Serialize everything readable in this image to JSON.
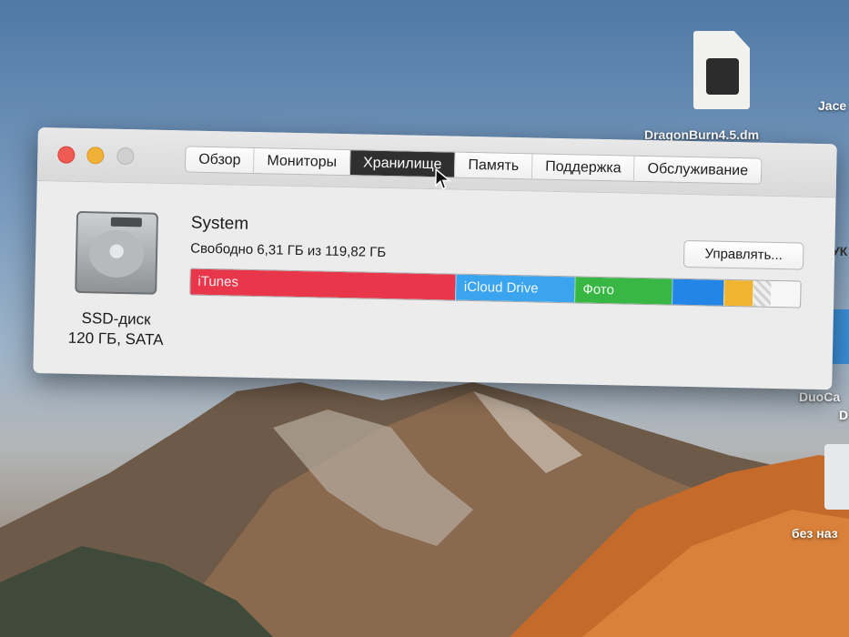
{
  "desktop": {
    "file_label": "DragonBurn4.5.dm",
    "edge_label_1": "Jace",
    "edge_label_2": "DuoCa",
    "edge_label_3": "без наз",
    "edge_letters_a": "УК",
    "edge_letters_b": "D"
  },
  "window": {
    "tabs": [
      {
        "label": "Обзор",
        "active": false
      },
      {
        "label": "Мониторы",
        "active": false
      },
      {
        "label": "Хранилище",
        "active": true
      },
      {
        "label": "Память",
        "active": false
      },
      {
        "label": "Поддержка",
        "active": false
      },
      {
        "label": "Обслуживание",
        "active": false
      }
    ],
    "disk": {
      "name_line1": "SSD-диск",
      "name_line2": "120 ГБ, SATA"
    },
    "volume": {
      "name": "System",
      "free_text": "Свободно 6,31 ГБ из 119,82 ГБ",
      "manage_label": "Управлять..."
    },
    "storage_bar": [
      {
        "label": "iTunes",
        "fraction": 0.435,
        "color": "#e8364a"
      },
      {
        "label": "iCloud Drive",
        "fraction": 0.195,
        "color": "#3aa4ef"
      },
      {
        "label": "Фото",
        "fraction": 0.16,
        "color": "#38b745"
      },
      {
        "label": "",
        "fraction": 0.085,
        "color": "#2385e6"
      },
      {
        "label": "",
        "fraction": 0.047,
        "color": "#f0b431"
      },
      {
        "label": "",
        "fraction": 0.03,
        "color": "hatched"
      },
      {
        "label": "",
        "fraction": 0.048,
        "color": "#f6f6f6"
      }
    ]
  }
}
